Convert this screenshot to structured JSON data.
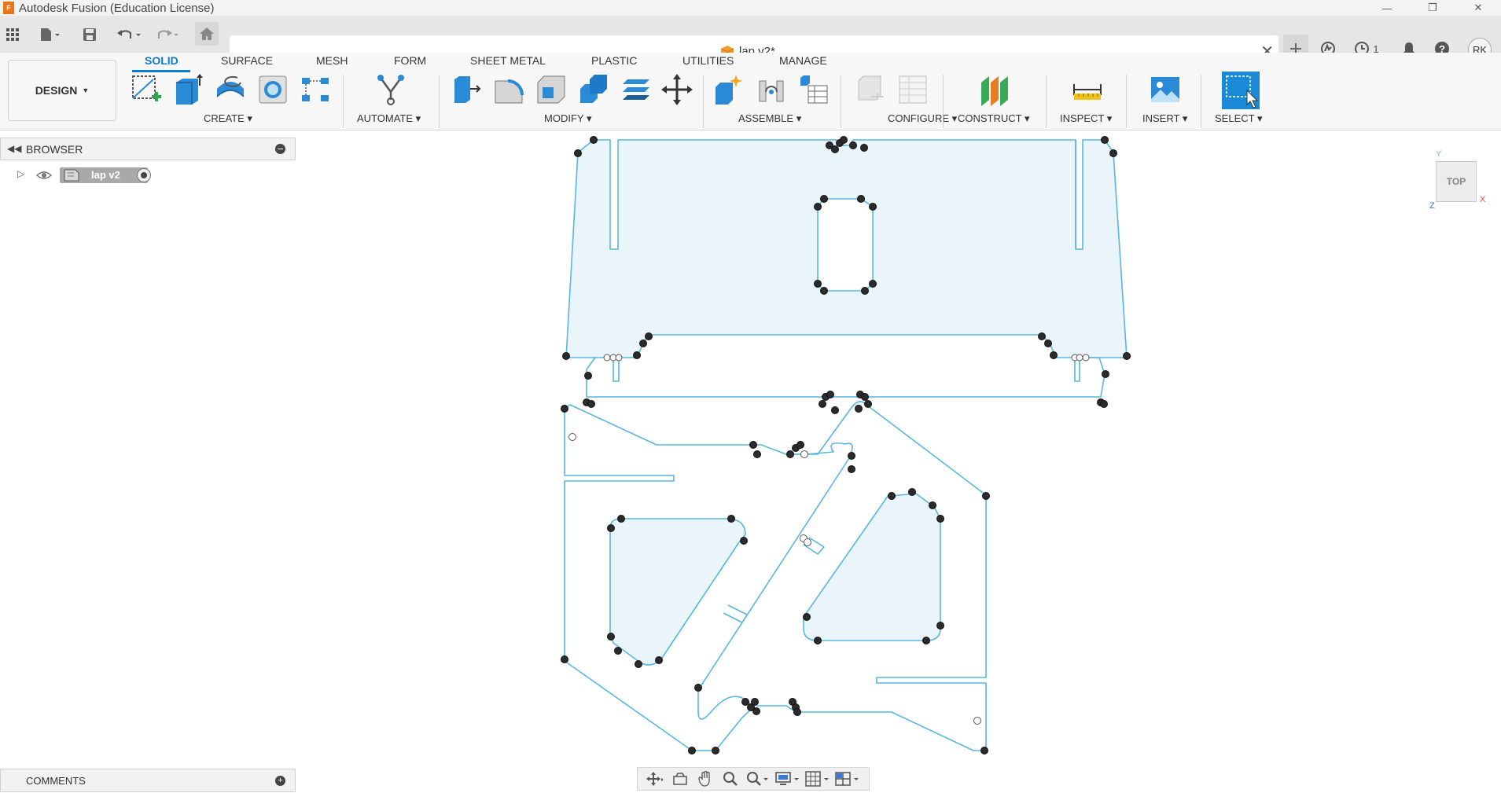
{
  "window": {
    "title": "Autodesk Fusion (Education License)",
    "logo_letter": "F"
  },
  "document": {
    "tab_title": "lap v2*"
  },
  "quick_access": {
    "job_status_count": "1",
    "user_initials": "RK"
  },
  "ribbon": {
    "workspace_label": "DESIGN",
    "tabs": [
      "SOLID",
      "SURFACE",
      "MESH",
      "FORM",
      "SHEET METAL",
      "PLASTIC",
      "UTILITIES",
      "MANAGE"
    ],
    "active_tab": "SOLID",
    "groups": [
      "CREATE",
      "AUTOMATE",
      "MODIFY",
      "ASSEMBLE",
      "CONFIGURE",
      "CONSTRUCT",
      "INSPECT",
      "INSERT",
      "SELECT"
    ]
  },
  "browser": {
    "title": "BROWSER",
    "root_item": "lap v2"
  },
  "comments": {
    "title": "COMMENTS"
  },
  "viewcube": {
    "face": "TOP",
    "axis_x": "X",
    "axis_y": "Y",
    "axis_z": "Z"
  },
  "colors": {
    "accent": "#0a7bd0",
    "sketch_line": "#58b6e0",
    "profile_fill": "#eaf4fb",
    "constraint_point": "#2b2b2b"
  }
}
